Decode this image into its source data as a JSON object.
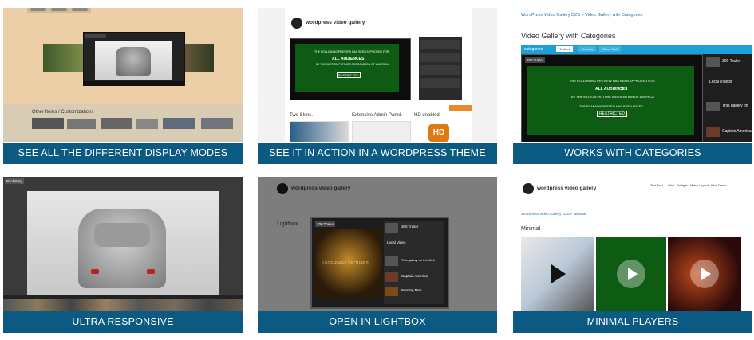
{
  "tiles": [
    {
      "caption": "SEE ALL THE DIFFERENT DISPLAY MODES",
      "other_label": "Other Items / Customizations"
    },
    {
      "caption": "SEE IT IN ACTION IN A WORDPRESS THEME",
      "site_title": "wordpress video gallery",
      "boxes": [
        "Two Skins.",
        "Extensive Admin Panel.",
        "HD enabled."
      ],
      "hd_badge": "HD",
      "trailer_text": [
        "THE FOLLOWING PREVIEW HAS BEEN APPROVED FOR",
        "ALL AUDIENCES",
        "BY THE MOTION PICTURE ASSOCIATION OF AMERICA",
        "RESTRICTED"
      ]
    },
    {
      "caption": "WORKS WITH CATEGORIES",
      "breadcrumb": "WordPress Video Gallery DZS » Video Gallery with Categories",
      "page_title": "Video Gallery with Categories",
      "category_label": "categories",
      "category_tabs": [
        "Trailers",
        "Animals",
        "Other Stuff"
      ],
      "player_tag": "300 Trailer",
      "side_items": [
        "300 Trailer",
        "Local Videos",
        "This gallery on",
        "Captain America"
      ],
      "trailer_text": [
        "THE FOLLOWING PREVIEW HAS BEEN APPROVED FOR",
        "ALL AUDIENCES",
        "BY THE MOTION PICTURE ASSOCIATION OF AMERICA",
        "THE FILM ADVERTISED HAS BEEN RATED",
        "RESTRICTED"
      ]
    },
    {
      "caption": "ULTRA RESPONSIVE",
      "tag": "Backstory"
    },
    {
      "caption": "OPEN IN LIGHTBOX",
      "site_title": "wordpress video gallery",
      "page_title": "Lightbox",
      "player_tag": "300 Trailer",
      "poster_text": "LEGENDARY PICTURES",
      "side_items": [
        "300 Trailer",
        "Local Video",
        "This gallery on the Web",
        "Captain America",
        "Burning Man"
      ]
    },
    {
      "caption": "MINIMAL PLAYERS",
      "site_title": "wordpress video gallery",
      "breadcrumb": "WordPress Video Gallery DZS » Minimal",
      "page_title": "Minimal",
      "nav": [
        "Test Text",
        "Wall",
        "Widget",
        "Menu Layout",
        "Wall Demo"
      ]
    }
  ],
  "colors": {
    "caption_bg": "#0a5a82",
    "trailer_green": "#0e5c14",
    "accent_blue": "#1e9fd6",
    "hd_orange": "#e07a10"
  }
}
